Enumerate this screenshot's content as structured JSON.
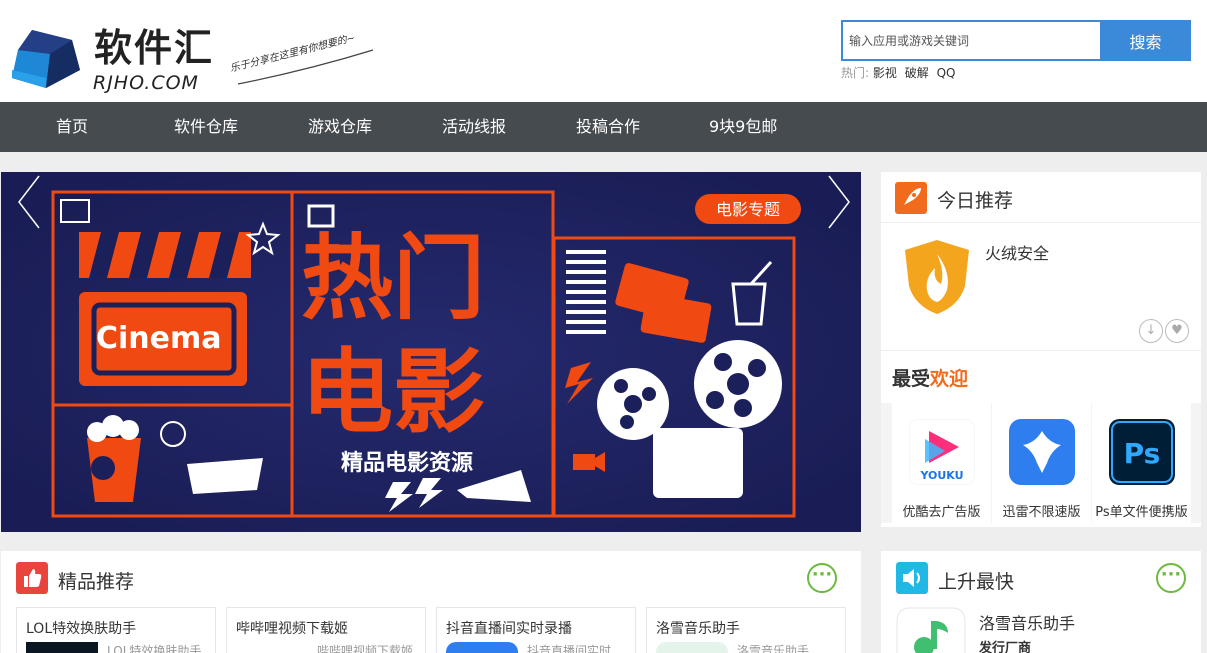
{
  "header": {
    "logo_cn": "软件汇",
    "logo_en": "RJHO.COM",
    "slogan": "乐于分享在这里有你想要的~",
    "search_placeholder": "输入应用或游戏关键词",
    "search_button": "搜索",
    "hot_label": "热门:",
    "hot_links": [
      "影视",
      "破解",
      "QQ"
    ]
  },
  "nav": {
    "items": [
      "首页",
      "软件仓库",
      "游戏仓库",
      "活动线报",
      "投稿合作",
      "9块9包邮"
    ]
  },
  "banner": {
    "tag": "电影专题",
    "title_line1": "热门",
    "title_line2": "电影",
    "subtitle": "精品电影资源",
    "cinema_text": "Cinema",
    "colors": {
      "background": "#1b1f5a",
      "accent": "#f04a12"
    }
  },
  "today": {
    "title": "今日推荐",
    "app_name": "火绒安全"
  },
  "popular": {
    "title_prefix": "最受",
    "title_accent": "欢迎",
    "items": [
      {
        "label": "优酷去广告版",
        "icon": "youku-icon",
        "icon_text": "YOUKU"
      },
      {
        "label": "迅雷不限速版",
        "icon": "xunlei-icon"
      },
      {
        "label": "Ps单文件便携版",
        "icon": "photoshop-icon",
        "icon_text": "Ps"
      }
    ]
  },
  "featured": {
    "title": "精品推荐",
    "more": "···",
    "cards": [
      {
        "title": "LOL特效换肤助手",
        "sub": "LOL特效换肤助手"
      },
      {
        "title": "哔哔哩视频下载姬",
        "sub": "哔哔哩视频下载姬"
      },
      {
        "title": "抖音直播间实时录播",
        "sub": "抖音直播间实时..."
      },
      {
        "title": "洛雪音乐助手",
        "sub": "洛雪音乐助手"
      }
    ]
  },
  "rising": {
    "title": "上升最快",
    "more": "···",
    "app_name": "洛雪音乐助手",
    "developer": "发行厂商"
  }
}
